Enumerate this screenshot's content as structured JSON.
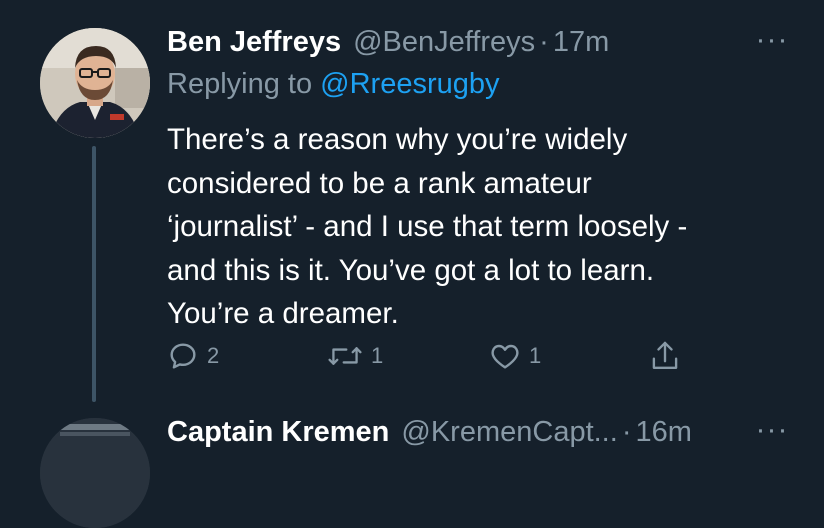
{
  "tweet": {
    "author_name": "Ben Jeffreys",
    "author_handle": "@BenJeffreys",
    "separator": "·",
    "time": "17m",
    "replying_prefix": "Replying to",
    "replying_to": "@Rreesrugby",
    "text_lines": [
      "There’s a reason why you’re widely",
      "considered to be a rank amateur",
      "‘journalist’ - and I use that term loosely -",
      "and this is it. You’ve got a lot to learn.",
      "You’re a dreamer."
    ],
    "reply_count": "2",
    "retweet_count": "1",
    "like_count": "1",
    "more_label": "···"
  },
  "next_tweet": {
    "author_name": "Captain Kremen",
    "author_handle": "@KremenCapt...",
    "separator": "·",
    "time": "16m",
    "more_label": "···"
  },
  "colors": {
    "background": "#15202b",
    "primary_text": "#ffffff",
    "secondary_text": "#8899a6",
    "link": "#1da1f2",
    "thread_line": "#3d5466"
  },
  "icons": {
    "reply": "reply-icon",
    "retweet": "retweet-icon",
    "like": "heart-icon",
    "share": "share-icon",
    "more": "more-icon"
  }
}
